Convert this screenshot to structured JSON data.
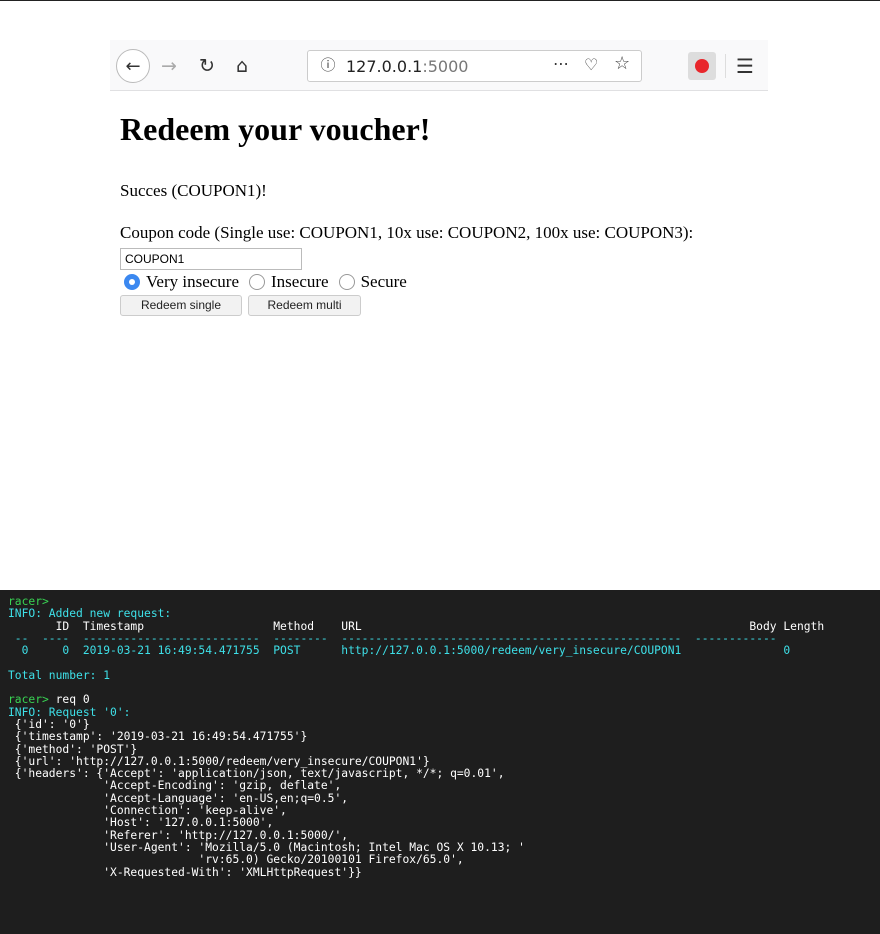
{
  "browser": {
    "url_host": "127.0.0.1",
    "url_port": ":5000",
    "icons": {
      "back": "back-arrow-icon",
      "forward": "forward-arrow-icon",
      "reload": "reload-icon",
      "home": "home-icon",
      "info": "info-icon",
      "more": "more-icon",
      "pocket": "pocket-icon",
      "bookmark": "star-icon",
      "record": "record-icon",
      "menu": "hamburger-menu-icon"
    }
  },
  "page": {
    "title": "Redeem your voucher!",
    "status": "Succes (COUPON1)!",
    "coupon_label": "Coupon code (Single use: COUPON1, 10x use: COUPON2, 100x use: COUPON3):",
    "coupon_value": "COUPON1",
    "radios": [
      {
        "label": "Very insecure",
        "checked": true
      },
      {
        "label": "Insecure",
        "checked": false
      },
      {
        "label": "Secure",
        "checked": false
      }
    ],
    "buttons": {
      "single": "Redeem single",
      "multi": "Redeem multi"
    }
  },
  "terminal": {
    "prompt": "racer>",
    "info_added": "INFO: Added new request:",
    "table_header": "       ID  Timestamp                   Method    URL                                                         Body Length",
    "table_sep": " --  ----  --------------------------  --------  --------------------------------------------------  ------------",
    "table_row": "  0     0  2019-03-21 16:49:54.471755  POST      http://127.0.0.1:5000/redeem/very_insecure/COUPON1               0",
    "total": "Total number: 1",
    "command": "req 0",
    "info_request": "INFO: Request '0':",
    "request_lines": [
      " {'id': '0'}",
      " {'timestamp': '2019-03-21 16:49:54.471755'}",
      " {'method': 'POST'}",
      " {'url': 'http://127.0.0.1:5000/redeem/very_insecure/COUPON1'}",
      " {'headers': {'Accept': 'application/json, text/javascript, */*; q=0.01',",
      "              'Accept-Encoding': 'gzip, deflate',",
      "              'Accept-Language': 'en-US,en;q=0.5',",
      "              'Connection': 'keep-alive',",
      "              'Host': '127.0.0.1:5000',",
      "              'Referer': 'http://127.0.0.1:5000/',",
      "              'User-Agent': 'Mozilla/5.0 (Macintosh; Intel Mac OS X 10.13; '",
      "                            'rv:65.0) Gecko/20100101 Firefox/65.0',",
      "              'X-Requested-With': 'XMLHttpRequest'}}"
    ]
  }
}
